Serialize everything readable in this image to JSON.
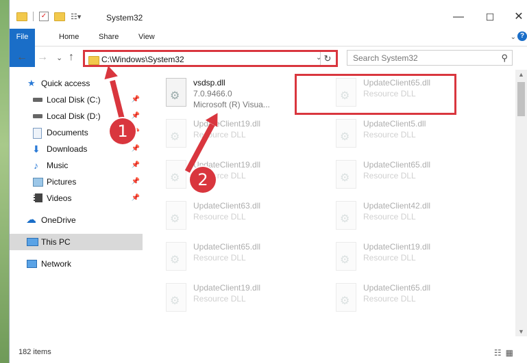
{
  "window": {
    "title": "System32"
  },
  "window_controls": {
    "minimize": "—",
    "maximize": "☐",
    "close": "✕"
  },
  "ribbon": {
    "tabs": [
      "File",
      "Home",
      "Share",
      "View"
    ]
  },
  "navigation": {
    "back": "←",
    "forward": "→",
    "recent": "⌄",
    "up": "↑",
    "address": "C:\\Windows\\System32",
    "search_placeholder": "Search System32"
  },
  "sidebar": {
    "items": [
      {
        "label": "Quick access",
        "icon": "star-icon"
      },
      {
        "label": "Local Disk (C:)",
        "icon": "drive-icon",
        "pinned": true
      },
      {
        "label": "Local Disk (D:)",
        "icon": "drive-icon",
        "pinned": true
      },
      {
        "label": "Documents",
        "icon": "documents-icon",
        "pinned": true
      },
      {
        "label": "Downloads",
        "icon": "download-icon",
        "pinned": true
      },
      {
        "label": "Music",
        "icon": "music-icon",
        "pinned": true
      },
      {
        "label": "Pictures",
        "icon": "pictures-icon",
        "pinned": true
      },
      {
        "label": "Videos",
        "icon": "videos-icon",
        "pinned": true
      },
      {
        "label": "OneDrive",
        "icon": "cloud-icon"
      },
      {
        "label": "This PC",
        "icon": "computer-icon",
        "selected": true
      },
      {
        "label": "Network",
        "icon": "network-icon"
      }
    ]
  },
  "files": [
    {
      "name": "vsdsp.dll",
      "line2": "7.0.9466.0",
      "line3": "Microsoft (R) Visua...",
      "highlighted": true
    },
    {
      "name": "UpdateClient65.dll",
      "line2": "Resource DLL"
    },
    {
      "name": "UpdateClient19.dll",
      "line2": "Resource DLL"
    },
    {
      "name": "UpdateClient5.dll",
      "line2": "Resource DLL"
    },
    {
      "name": "UpdateClient19.dll",
      "line2": "Resource DLL"
    },
    {
      "name": "UpdateClient65.dll",
      "line2": "Resource DLL"
    },
    {
      "name": "UpdateClient63.dll",
      "line2": "Resource DLL"
    },
    {
      "name": "UpdateClient42.dll",
      "line2": "Resource DLL"
    },
    {
      "name": "UpdateClient65.dll",
      "line2": "Resource DLL"
    },
    {
      "name": "UpdateClient19.dll",
      "line2": "Resource DLL"
    },
    {
      "name": "UpdateClient19.dll",
      "line2": "Resource DLL"
    },
    {
      "name": "UpdateClient65.dll",
      "line2": "Resource DLL"
    }
  ],
  "status": {
    "item_count": "182 items"
  },
  "annotations": {
    "step1": "1",
    "step2": "2"
  },
  "colors": {
    "accent": "#1a6ec8",
    "highlight": "#d9363e",
    "folder": "#f2c94c"
  }
}
